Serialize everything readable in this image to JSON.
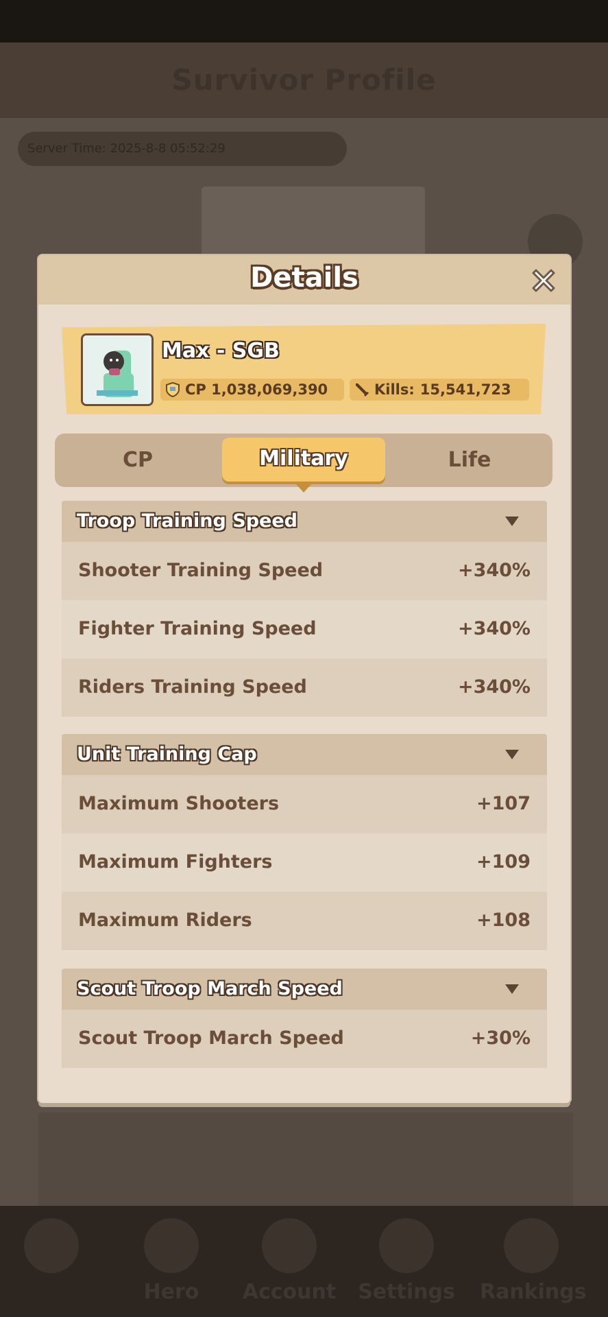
{
  "background": {
    "title": "Survivor Profile",
    "server_time": "Server Time: 2025-8-8 05:52:29",
    "nav": [
      {
        "label": "",
        "icon": "back-icon"
      },
      {
        "label": "Hero",
        "icon": "hero-icon"
      },
      {
        "label": "Account",
        "icon": "account-icon"
      },
      {
        "label": "Settings",
        "icon": "settings-icon"
      },
      {
        "label": "Rankings",
        "icon": "rankings-icon"
      }
    ]
  },
  "modal": {
    "title": "Details",
    "close_icon": "close-icon"
  },
  "player": {
    "name": "Max - SGB",
    "cp_label": "CP 1,038,069,390",
    "kills_label": "Kills:",
    "kills_value": "15,541,723",
    "cp_icon": "shield-icon",
    "kills_icon": "sword-icon"
  },
  "tabs": [
    {
      "label": "CP",
      "active": false
    },
    {
      "label": "Military",
      "active": true
    },
    {
      "label": "Life",
      "active": false
    }
  ],
  "sections": [
    {
      "title": "Troop Training Speed",
      "rows": [
        {
          "label": "Shooter Training Speed",
          "value": "+340%"
        },
        {
          "label": "Fighter Training Speed",
          "value": "+340%"
        },
        {
          "label": "Riders Training Speed",
          "value": "+340%"
        }
      ]
    },
    {
      "title": "Unit Training Cap",
      "rows": [
        {
          "label": "Maximum Shooters",
          "value": "+107"
        },
        {
          "label": "Maximum Fighters",
          "value": "+109"
        },
        {
          "label": "Maximum Riders",
          "value": "+108"
        }
      ]
    },
    {
      "title": "Scout Troop March Speed",
      "rows": [
        {
          "label": "Scout Troop March Speed",
          "value": "+30%"
        }
      ]
    }
  ],
  "colors": {
    "accent": "#f6c76a",
    "panel": "#e9dccc",
    "text_brown": "#6b4e3a"
  }
}
